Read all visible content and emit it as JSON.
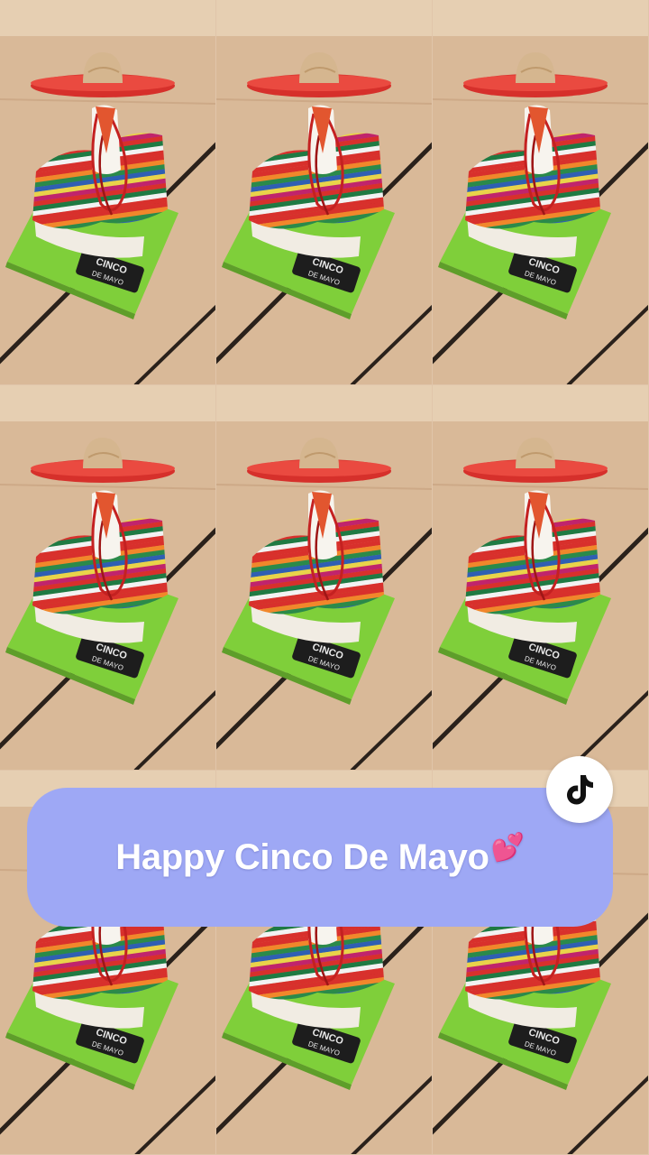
{
  "overlay": {
    "caption": "Happy Cinco De Mayo",
    "emoji": "💕"
  },
  "figurine": {
    "sign_text": "CINCO DE MAYO"
  },
  "icons": {
    "tiktok": "tiktok-logo-icon"
  },
  "colors": {
    "banner": "#9ea8f5",
    "caption_text": "#ffffff",
    "sombrero": "#d6302b",
    "base": "#7fcf3a",
    "table": "#d9b998"
  }
}
